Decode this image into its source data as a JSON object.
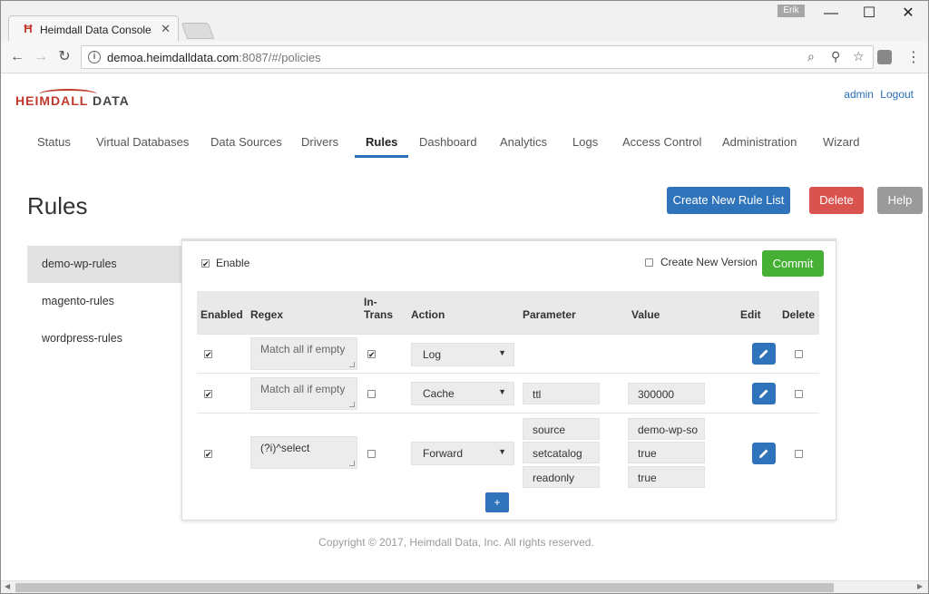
{
  "browser": {
    "tab_title": "Heimdall Data Console",
    "user_badge": "Erik",
    "url_host": "demoa.heimdalldata.com",
    "url_rest": ":8087/#/policies"
  },
  "header": {
    "logo_left": "HEIMDALL",
    "logo_right": "DATA",
    "auth_user": "admin",
    "auth_logout": "Logout"
  },
  "nav": {
    "tabs": [
      "Status",
      "Virtual Databases",
      "Data Sources",
      "Drivers",
      "Rules",
      "Dashboard",
      "Analytics",
      "Logs",
      "Access Control",
      "Administration",
      "Wizard"
    ],
    "active": "Rules"
  },
  "page": {
    "title": "Rules",
    "create_button": "Create New Rule List",
    "delete_button": "Delete",
    "help_button": "Help"
  },
  "sidebar": {
    "items": [
      "demo-wp-rules",
      "magento-rules",
      "wordpress-rules"
    ],
    "active": "demo-wp-rules"
  },
  "panel": {
    "enable_label": "Enable",
    "enable_checked": true,
    "new_version_label": "Create New Version",
    "new_version_checked": false,
    "commit_button": "Commit",
    "columns": {
      "enabled": "Enabled",
      "regex": "Regex",
      "in_trans_1": "In-",
      "in_trans_2": "Trans",
      "action": "Action",
      "parameter": "Parameter",
      "value": "Value",
      "edit": "Edit",
      "delete": "Delete"
    },
    "rows": [
      {
        "enabled": true,
        "regex_placeholder": "Match all if empty",
        "in_trans": true,
        "action": "Log",
        "params": [],
        "delete": false
      },
      {
        "enabled": true,
        "regex_placeholder": "Match all if empty",
        "in_trans": false,
        "action": "Cache",
        "params": [
          {
            "name": "ttl",
            "value": "300000"
          }
        ],
        "delete": false
      },
      {
        "enabled": true,
        "regex": "(?i)^select",
        "in_trans": false,
        "action": "Forward",
        "params": [
          {
            "name": "source",
            "value": "demo-wp-so"
          },
          {
            "name": "setcatalog",
            "value": "true"
          },
          {
            "name": "readonly",
            "value": "true"
          }
        ],
        "delete": false
      }
    ],
    "add_button": "+"
  },
  "footer": {
    "copyright": "Copyright © 2017, Heimdall Data, Inc. All rights reserved."
  }
}
